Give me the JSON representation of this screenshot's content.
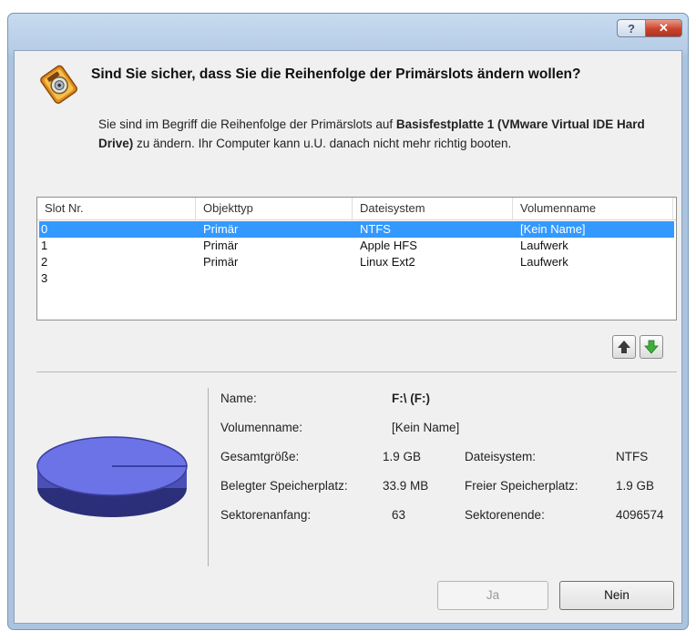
{
  "titlebar": {
    "help_label": "?",
    "close_label": "✕"
  },
  "dialog": {
    "headline": "Sind Sie sicher, dass Sie die Reihenfolge der Primärslots ändern wollen?",
    "desc_1": "Sie sind im Begriff die Reihenfolge der Primärslots auf ",
    "desc_bold": "Basisfestplatte 1 (VMware Virtual IDE Hard Drive)",
    "desc_2": " zu ändern. Ihr Computer kann u.U. danach nicht mehr richtig booten."
  },
  "table": {
    "columns": [
      "Slot Nr.",
      "Objekttyp",
      "Dateisystem",
      "Volumenname"
    ],
    "rows": [
      {
        "slot": "0",
        "type": "Primär",
        "fs": "NTFS",
        "volume": "[Kein Name]",
        "selected": true
      },
      {
        "slot": "1",
        "type": "Primär",
        "fs": "Apple HFS",
        "volume": "Laufwerk",
        "selected": false
      },
      {
        "slot": "2",
        "type": "Primär",
        "fs": "Linux Ext2",
        "volume": "Laufwerk",
        "selected": false
      },
      {
        "slot": "3",
        "type": "",
        "fs": "",
        "volume": "",
        "selected": false
      }
    ]
  },
  "details": {
    "name_label": "Name:",
    "name_value": "F:\\ (F:)",
    "volume_label": "Volumenname:",
    "volume_value": "[Kein Name]",
    "total_label": "Gesamtgröße:",
    "total_value": "1.9 GB",
    "fs_label": "Dateisystem:",
    "fs_value": "NTFS",
    "used_label": "Belegter Speicherplatz:",
    "used_value": "33.9 MB",
    "free_label": "Freier Speicherplatz:",
    "free_value": "1.9 GB",
    "start_label": "Sektorenanfang:",
    "start_value": "63",
    "end_label": "Sektorenende:",
    "end_value": "4096574"
  },
  "buttons": {
    "yes": "Ja",
    "no": "Nein"
  },
  "colors": {
    "selection": "#3399ff",
    "disk": "#6b73e6",
    "arrow_green": "#3fae3f"
  },
  "icons": {
    "warning": "disk-warning-icon",
    "up": "arrow-up-icon",
    "down": "arrow-down-icon"
  }
}
